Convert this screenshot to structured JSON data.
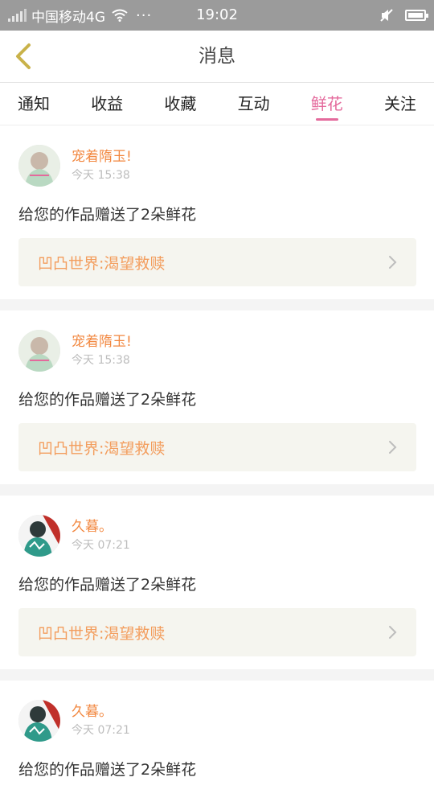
{
  "status_bar": {
    "carrier": "中国移动4G",
    "dots": "···",
    "time": "19:02"
  },
  "header": {
    "back_icon": "chevron-left-icon",
    "title": "消息"
  },
  "tabs": [
    {
      "label": "通知",
      "active": false
    },
    {
      "label": "收益",
      "active": false
    },
    {
      "label": "收藏",
      "active": false
    },
    {
      "label": "互动",
      "active": false
    },
    {
      "label": "鲜花",
      "active": true
    },
    {
      "label": "关注",
      "active": false
    }
  ],
  "colors": {
    "accent": "#e46a9c",
    "name": "#f2873f",
    "link_text": "#f39d5d",
    "link_bg": "#f5f5ef"
  },
  "messages": [
    {
      "name": "宠着隋玉!",
      "time": "今天 15:38",
      "text": "给您的作品赠送了2朵鲜花",
      "work": "凹凸世界:渴望救赎"
    },
    {
      "name": "宠着隋玉!",
      "time": "今天 15:38",
      "text": "给您的作品赠送了2朵鲜花",
      "work": "凹凸世界:渴望救赎"
    },
    {
      "name": "久暮。",
      "time": "今天 07:21",
      "text": "给您的作品赠送了2朵鲜花",
      "work": "凹凸世界:渴望救赎"
    },
    {
      "name": "久暮。",
      "time": "今天 07:21",
      "text": "给您的作品赠送了2朵鲜花"
    }
  ]
}
